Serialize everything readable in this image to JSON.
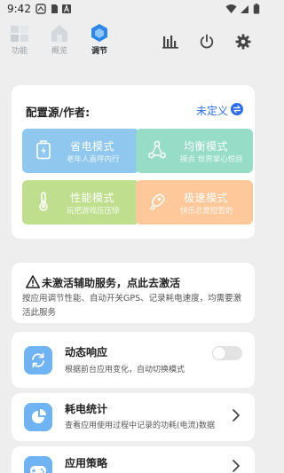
{
  "status_bar": {
    "time": "9:42",
    "icons": [
      "notification-icon",
      "sim-icon",
      "text-a-icon",
      "wifi-icon",
      "signal-icon",
      "battery-icon"
    ]
  },
  "tabs": [
    {
      "label": "功能",
      "icon": "puzzle-icon",
      "active": false
    },
    {
      "label": "概览",
      "icon": "home-icon",
      "active": false
    },
    {
      "label": "调节",
      "icon": "hexagon-icon",
      "active": true
    }
  ],
  "toolbar_icons": [
    "bar-chart-icon",
    "power-icon",
    "gear-icon"
  ],
  "config": {
    "label": "配置源/作者:",
    "value": "未定义",
    "modes": [
      {
        "title": "省电模式",
        "subtitle": "老年人直呼内行",
        "color": "#8fc7ef",
        "icon": "battery-icon"
      },
      {
        "title": "均衡模式",
        "subtitle": "摸点 世界掌心悦目",
        "color": "#96dcc6",
        "icon": "network-icon"
      },
      {
        "title": "性能模式",
        "subtitle": "玩把游戏压压惊",
        "color": "#bfdf8e",
        "icon": "thermometer-icon"
      },
      {
        "title": "极速模式",
        "subtitle": "快乐总是短暂的",
        "color": "#ffc89a",
        "icon": "rocket-icon"
      }
    ]
  },
  "warning": {
    "title": "未激活辅助服务，点此去激活",
    "body": "按应用调节性能、自动开关GPS、记录耗电速度，均需要激活此服务"
  },
  "features": [
    {
      "title": "动态响应",
      "desc": "根据前台应用变化，自动切换模式",
      "control": "toggle",
      "enabled": false
    },
    {
      "title": "耗电统计",
      "desc": "查看应用使用过程中记录的功耗(电流)数据",
      "control": "chevron"
    },
    {
      "title": "应用策略",
      "desc": "",
      "control": "chevron"
    }
  ],
  "colors": {
    "accent": "#2f6ee8",
    "icon_blue": "#6fb3f3",
    "page_bg": "#eeeeee"
  }
}
